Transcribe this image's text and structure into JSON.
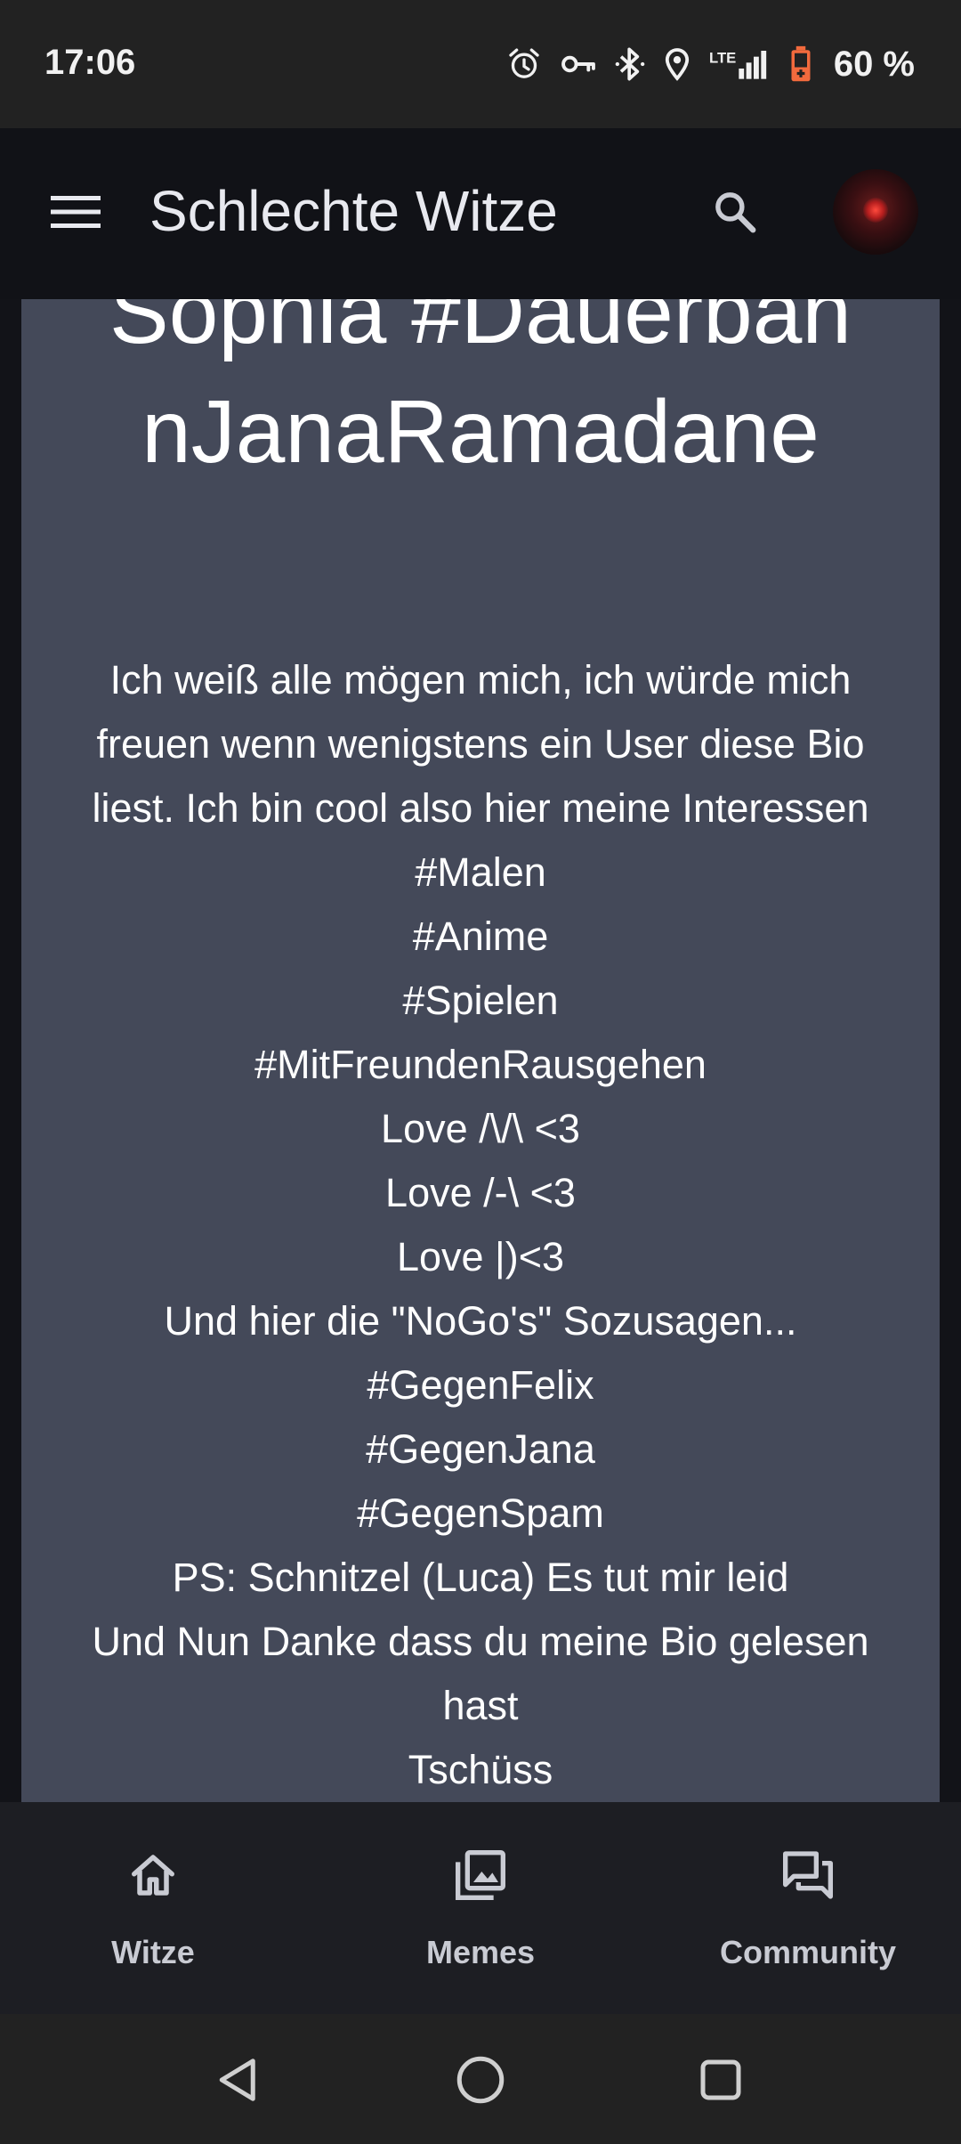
{
  "status_bar": {
    "time": "17:06",
    "battery_text": "60 %",
    "icons": [
      "alarm-icon",
      "vpn-key-icon",
      "bluetooth-icon",
      "location-icon",
      "lte-signal-icon",
      "battery-saver-icon"
    ],
    "network_label": "LTE",
    "battery_color": "#f26a3d"
  },
  "app_bar": {
    "title": "Schlechte Witze",
    "icons": [
      "menu-icon",
      "search-icon",
      "avatar"
    ]
  },
  "profile": {
    "name": "Sophia #DauerbannJanaRamadane",
    "bio_lines": [
      "Ich weiß alle mögen mich, ich würde mich",
      "freuen wenn wenigstens ein User diese Bio",
      "liest. Ich bin cool also hier meine Interessen",
      "#Malen",
      "#Anime",
      "#Spielen",
      "#MitFreundenRausgehen",
      "Love /\\/\\ <3",
      "Love /-\\ <3",
      "Love |)<3",
      "Und hier die \"NoGo's\" Sozusagen...",
      "#GegenFelix",
      "#GegenJana",
      "#GegenSpam",
      "PS: Schnitzel (Luca) Es tut mir leid",
      "Und Nun Danke dass du meine Bio gelesen",
      "hast",
      "Tschüss"
    ]
  },
  "bottom_nav": {
    "items": [
      {
        "label": "Witze",
        "icon": "home-icon"
      },
      {
        "label": "Memes",
        "icon": "photo-library-icon"
      },
      {
        "label": "Community",
        "icon": "forum-icon"
      }
    ]
  },
  "system_nav": {
    "buttons": [
      "back-icon",
      "home-circle-icon",
      "recents-icon"
    ]
  },
  "colors": {
    "status_bar_bg": "#222222",
    "app_bar_bg": "#111217",
    "card_bg": "#444959",
    "bottom_nav_bg": "#1d1e23",
    "text": "#ffffff"
  }
}
